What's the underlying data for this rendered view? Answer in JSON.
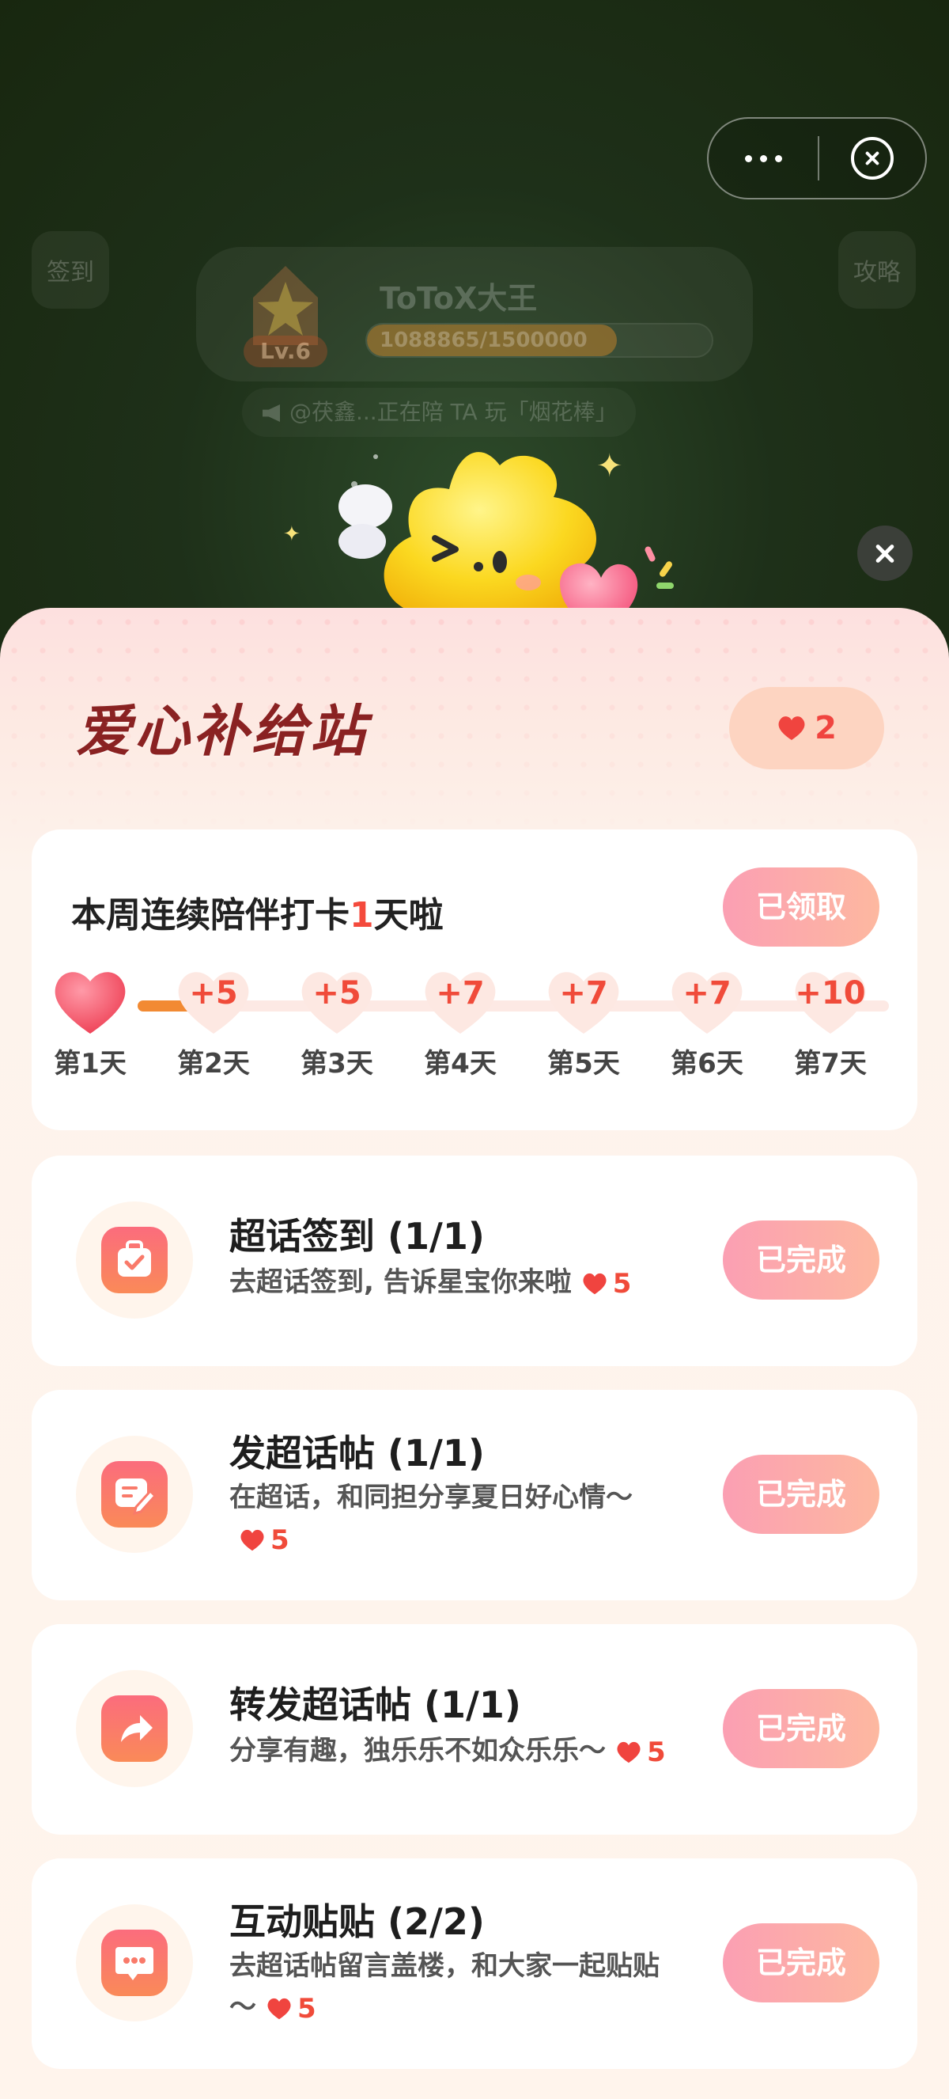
{
  "background": {
    "left_button": "签到",
    "right_button": "攻略",
    "username": "ToToX大王",
    "level": "Lv.6",
    "xp_text": "1088865/1500000",
    "xp_progress": 0.7259,
    "notice": "@茯鑫...正在陪 TA 玩「烟花棒」"
  },
  "sheet": {
    "title": "爱心补给站",
    "heart_count": "2"
  },
  "streak": {
    "title_prefix": "本周连续陪伴打卡",
    "title_count": "1",
    "title_suffix": "天啦",
    "button_label": "已领取",
    "days": [
      {
        "label": "第1天",
        "reward": ""
      },
      {
        "label": "第2天",
        "reward": "+5"
      },
      {
        "label": "第3天",
        "reward": "+5"
      },
      {
        "label": "第4天",
        "reward": "+7"
      },
      {
        "label": "第5天",
        "reward": "+7"
      },
      {
        "label": "第6天",
        "reward": "+7"
      },
      {
        "label": "第7天",
        "reward": "+10"
      }
    ]
  },
  "tasks": [
    {
      "title": "超话签到 (1/1)",
      "desc": "去超话签到, 告诉星宝你来啦",
      "reward": "5",
      "button": "已完成",
      "icon": "check-bag-icon"
    },
    {
      "title": "发超话帖 (1/1)",
      "desc": " 在超话，和同担分享夏日好心情～",
      "reward": "5",
      "button": "已完成",
      "icon": "edit-post-icon"
    },
    {
      "title": "转发超话帖 (1/1)",
      "desc": "分享有趣，独乐乐不如众乐乐～",
      "reward": "5",
      "button": "已完成",
      "icon": "share-arrow-icon"
    },
    {
      "title": "互动贴贴 (2/2)",
      "desc": "去超话帖留言盖楼，和大家一起贴贴～",
      "reward": "5",
      "button": "已完成",
      "icon": "chat-bubble-icon"
    }
  ],
  "colors": {
    "accent": "#f04b3a",
    "button_gradient_start": "#fb9fb3",
    "button_gradient_end": "#fdb8a0",
    "title": "#8a2222"
  }
}
